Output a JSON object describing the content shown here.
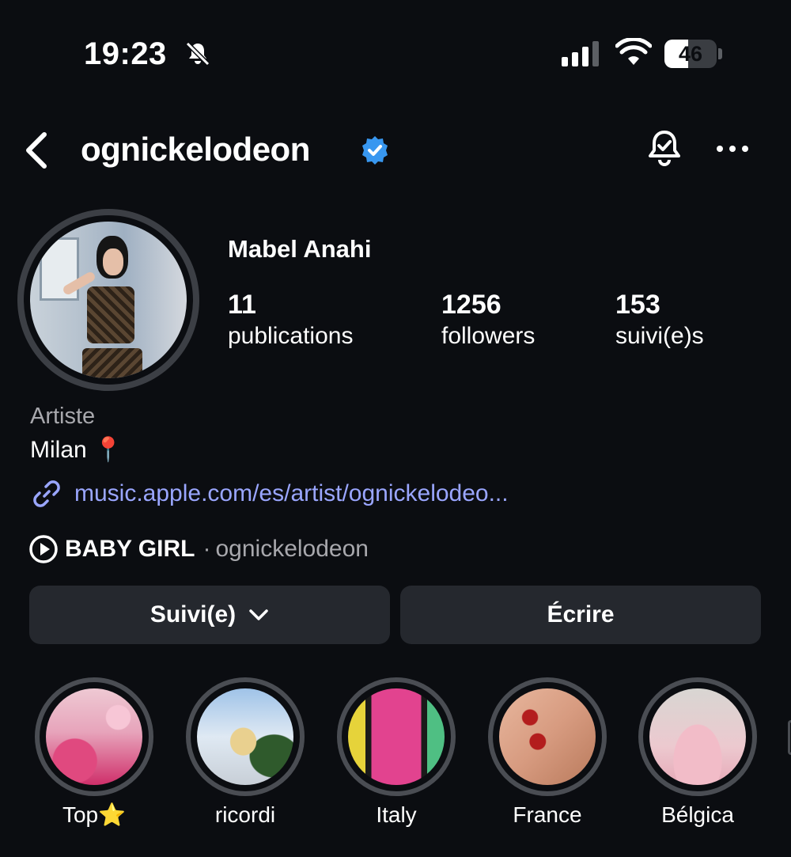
{
  "status_bar": {
    "time": "19:23",
    "battery": "46",
    "battery_level": 0.46
  },
  "header": {
    "username": "ognickelodeon",
    "verified": true
  },
  "profile": {
    "display_name": "Mabel Anahi",
    "stats": [
      {
        "value": "11",
        "label": "publications"
      },
      {
        "value": "1256",
        "label": "followers"
      },
      {
        "value": "153",
        "label": "suivi(e)s"
      }
    ]
  },
  "bio": {
    "category": "Artiste",
    "location": "Milan 📍",
    "link": "music.apple.com/es/artist/ognickelodeo...",
    "song_title": "BABY GIRL",
    "song_separator": "·",
    "song_artist": "ognickelodeon"
  },
  "actions": {
    "following_label": "Suivi(e)",
    "message_label": "Écrire"
  },
  "highlights": [
    {
      "label": "Top⭐"
    },
    {
      "label": "ricordi"
    },
    {
      "label": "Italy"
    },
    {
      "label": "France"
    },
    {
      "label": "Bélgica"
    }
  ],
  "colors": {
    "background": "#0b0d11",
    "link": "#9aa6ff",
    "verified": "#3897f0",
    "button": "#25282e"
  }
}
